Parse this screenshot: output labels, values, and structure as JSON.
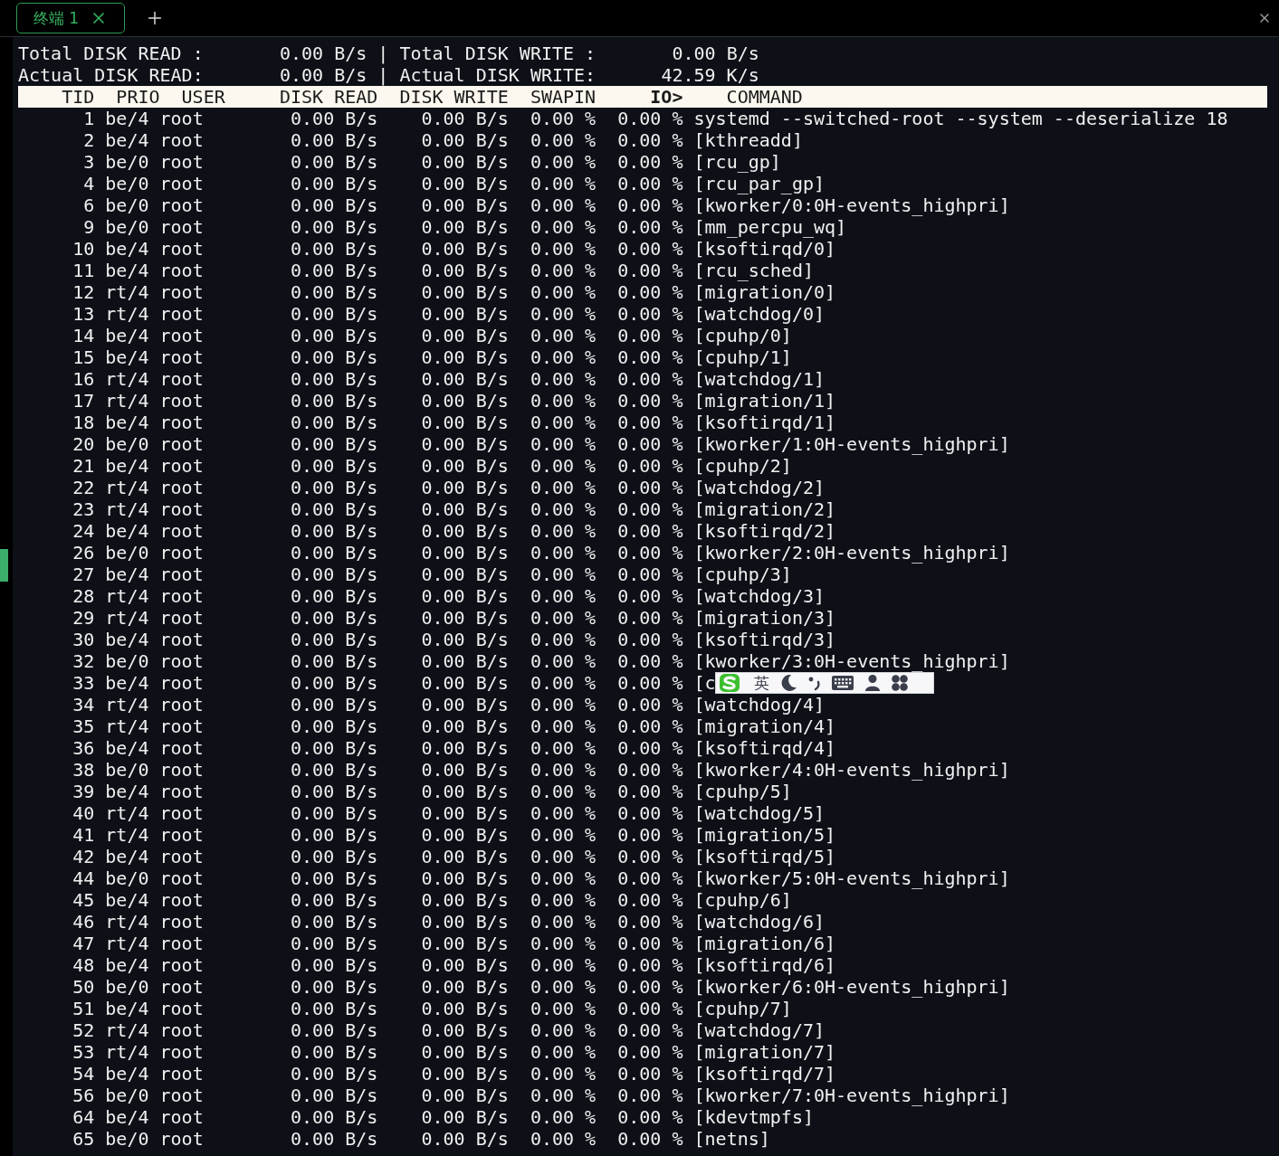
{
  "tabs": [
    {
      "label": "终端 1",
      "selected": true
    }
  ],
  "summary": [
    {
      "label": "Total DISK READ :",
      "value": "0.00 B/s",
      "separator": "|",
      "label2": "Total DISK WRITE :",
      "value2": "0.00 B/s"
    },
    {
      "label": "Actual DISK READ:",
      "value": "0.00 B/s",
      "separator": "|",
      "label2": "Actual DISK WRITE:",
      "value2": "42.59 K/s"
    }
  ],
  "columns": [
    {
      "label": "TID",
      "sorted": false
    },
    {
      "label": "PRIO",
      "sorted": false
    },
    {
      "label": "USER",
      "sorted": false
    },
    {
      "label": "DISK READ",
      "sorted": false
    },
    {
      "label": "DISK WRITE",
      "sorted": false
    },
    {
      "label": "SWAPIN",
      "sorted": false
    },
    {
      "label": "IO>",
      "sorted": true
    },
    {
      "label": "COMMAND",
      "sorted": false
    }
  ],
  "rows": [
    {
      "tid": "1",
      "prio": "be/4",
      "user": "root",
      "disk_read": "0.00 B/s",
      "disk_write": "0.00 B/s",
      "swapin": "0.00 %",
      "io": "0.00 %",
      "command": "systemd --switched-root --system --deserialize 18"
    },
    {
      "tid": "2",
      "prio": "be/4",
      "user": "root",
      "disk_read": "0.00 B/s",
      "disk_write": "0.00 B/s",
      "swapin": "0.00 %",
      "io": "0.00 %",
      "command": "[kthreadd]"
    },
    {
      "tid": "3",
      "prio": "be/0",
      "user": "root",
      "disk_read": "0.00 B/s",
      "disk_write": "0.00 B/s",
      "swapin": "0.00 %",
      "io": "0.00 %",
      "command": "[rcu_gp]"
    },
    {
      "tid": "4",
      "prio": "be/0",
      "user": "root",
      "disk_read": "0.00 B/s",
      "disk_write": "0.00 B/s",
      "swapin": "0.00 %",
      "io": "0.00 %",
      "command": "[rcu_par_gp]"
    },
    {
      "tid": "6",
      "prio": "be/0",
      "user": "root",
      "disk_read": "0.00 B/s",
      "disk_write": "0.00 B/s",
      "swapin": "0.00 %",
      "io": "0.00 %",
      "command": "[kworker/0:0H-events_highpri]"
    },
    {
      "tid": "9",
      "prio": "be/0",
      "user": "root",
      "disk_read": "0.00 B/s",
      "disk_write": "0.00 B/s",
      "swapin": "0.00 %",
      "io": "0.00 %",
      "command": "[mm_percpu_wq]"
    },
    {
      "tid": "10",
      "prio": "be/4",
      "user": "root",
      "disk_read": "0.00 B/s",
      "disk_write": "0.00 B/s",
      "swapin": "0.00 %",
      "io": "0.00 %",
      "command": "[ksoftirqd/0]"
    },
    {
      "tid": "11",
      "prio": "be/4",
      "user": "root",
      "disk_read": "0.00 B/s",
      "disk_write": "0.00 B/s",
      "swapin": "0.00 %",
      "io": "0.00 %",
      "command": "[rcu_sched]"
    },
    {
      "tid": "12",
      "prio": "rt/4",
      "user": "root",
      "disk_read": "0.00 B/s",
      "disk_write": "0.00 B/s",
      "swapin": "0.00 %",
      "io": "0.00 %",
      "command": "[migration/0]"
    },
    {
      "tid": "13",
      "prio": "rt/4",
      "user": "root",
      "disk_read": "0.00 B/s",
      "disk_write": "0.00 B/s",
      "swapin": "0.00 %",
      "io": "0.00 %",
      "command": "[watchdog/0]"
    },
    {
      "tid": "14",
      "prio": "be/4",
      "user": "root",
      "disk_read": "0.00 B/s",
      "disk_write": "0.00 B/s",
      "swapin": "0.00 %",
      "io": "0.00 %",
      "command": "[cpuhp/0]"
    },
    {
      "tid": "15",
      "prio": "be/4",
      "user": "root",
      "disk_read": "0.00 B/s",
      "disk_write": "0.00 B/s",
      "swapin": "0.00 %",
      "io": "0.00 %",
      "command": "[cpuhp/1]"
    },
    {
      "tid": "16",
      "prio": "rt/4",
      "user": "root",
      "disk_read": "0.00 B/s",
      "disk_write": "0.00 B/s",
      "swapin": "0.00 %",
      "io": "0.00 %",
      "command": "[watchdog/1]"
    },
    {
      "tid": "17",
      "prio": "rt/4",
      "user": "root",
      "disk_read": "0.00 B/s",
      "disk_write": "0.00 B/s",
      "swapin": "0.00 %",
      "io": "0.00 %",
      "command": "[migration/1]"
    },
    {
      "tid": "18",
      "prio": "be/4",
      "user": "root",
      "disk_read": "0.00 B/s",
      "disk_write": "0.00 B/s",
      "swapin": "0.00 %",
      "io": "0.00 %",
      "command": "[ksoftirqd/1]"
    },
    {
      "tid": "20",
      "prio": "be/0",
      "user": "root",
      "disk_read": "0.00 B/s",
      "disk_write": "0.00 B/s",
      "swapin": "0.00 %",
      "io": "0.00 %",
      "command": "[kworker/1:0H-events_highpri]"
    },
    {
      "tid": "21",
      "prio": "be/4",
      "user": "root",
      "disk_read": "0.00 B/s",
      "disk_write": "0.00 B/s",
      "swapin": "0.00 %",
      "io": "0.00 %",
      "command": "[cpuhp/2]"
    },
    {
      "tid": "22",
      "prio": "rt/4",
      "user": "root",
      "disk_read": "0.00 B/s",
      "disk_write": "0.00 B/s",
      "swapin": "0.00 %",
      "io": "0.00 %",
      "command": "[watchdog/2]"
    },
    {
      "tid": "23",
      "prio": "rt/4",
      "user": "root",
      "disk_read": "0.00 B/s",
      "disk_write": "0.00 B/s",
      "swapin": "0.00 %",
      "io": "0.00 %",
      "command": "[migration/2]"
    },
    {
      "tid": "24",
      "prio": "be/4",
      "user": "root",
      "disk_read": "0.00 B/s",
      "disk_write": "0.00 B/s",
      "swapin": "0.00 %",
      "io": "0.00 %",
      "command": "[ksoftirqd/2]"
    },
    {
      "tid": "26",
      "prio": "be/0",
      "user": "root",
      "disk_read": "0.00 B/s",
      "disk_write": "0.00 B/s",
      "swapin": "0.00 %",
      "io": "0.00 %",
      "command": "[kworker/2:0H-events_highpri]"
    },
    {
      "tid": "27",
      "prio": "be/4",
      "user": "root",
      "disk_read": "0.00 B/s",
      "disk_write": "0.00 B/s",
      "swapin": "0.00 %",
      "io": "0.00 %",
      "command": "[cpuhp/3]"
    },
    {
      "tid": "28",
      "prio": "rt/4",
      "user": "root",
      "disk_read": "0.00 B/s",
      "disk_write": "0.00 B/s",
      "swapin": "0.00 %",
      "io": "0.00 %",
      "command": "[watchdog/3]"
    },
    {
      "tid": "29",
      "prio": "rt/4",
      "user": "root",
      "disk_read": "0.00 B/s",
      "disk_write": "0.00 B/s",
      "swapin": "0.00 %",
      "io": "0.00 %",
      "command": "[migration/3]"
    },
    {
      "tid": "30",
      "prio": "be/4",
      "user": "root",
      "disk_read": "0.00 B/s",
      "disk_write": "0.00 B/s",
      "swapin": "0.00 %",
      "io": "0.00 %",
      "command": "[ksoftirqd/3]"
    },
    {
      "tid": "32",
      "prio": "be/0",
      "user": "root",
      "disk_read": "0.00 B/s",
      "disk_write": "0.00 B/s",
      "swapin": "0.00 %",
      "io": "0.00 %",
      "command": "[kworker/3:0H-events_highpri]"
    },
    {
      "tid": "33",
      "prio": "be/4",
      "user": "root",
      "disk_read": "0.00 B/s",
      "disk_write": "0.00 B/s",
      "swapin": "0.00 %",
      "io": "0.00 %",
      "command": "[c"
    },
    {
      "tid": "34",
      "prio": "rt/4",
      "user": "root",
      "disk_read": "0.00 B/s",
      "disk_write": "0.00 B/s",
      "swapin": "0.00 %",
      "io": "0.00 %",
      "command": "[watchdog/4]"
    },
    {
      "tid": "35",
      "prio": "rt/4",
      "user": "root",
      "disk_read": "0.00 B/s",
      "disk_write": "0.00 B/s",
      "swapin": "0.00 %",
      "io": "0.00 %",
      "command": "[migration/4]"
    },
    {
      "tid": "36",
      "prio": "be/4",
      "user": "root",
      "disk_read": "0.00 B/s",
      "disk_write": "0.00 B/s",
      "swapin": "0.00 %",
      "io": "0.00 %",
      "command": "[ksoftirqd/4]"
    },
    {
      "tid": "38",
      "prio": "be/0",
      "user": "root",
      "disk_read": "0.00 B/s",
      "disk_write": "0.00 B/s",
      "swapin": "0.00 %",
      "io": "0.00 %",
      "command": "[kworker/4:0H-events_highpri]"
    },
    {
      "tid": "39",
      "prio": "be/4",
      "user": "root",
      "disk_read": "0.00 B/s",
      "disk_write": "0.00 B/s",
      "swapin": "0.00 %",
      "io": "0.00 %",
      "command": "[cpuhp/5]"
    },
    {
      "tid": "40",
      "prio": "rt/4",
      "user": "root",
      "disk_read": "0.00 B/s",
      "disk_write": "0.00 B/s",
      "swapin": "0.00 %",
      "io": "0.00 %",
      "command": "[watchdog/5]"
    },
    {
      "tid": "41",
      "prio": "rt/4",
      "user": "root",
      "disk_read": "0.00 B/s",
      "disk_write": "0.00 B/s",
      "swapin": "0.00 %",
      "io": "0.00 %",
      "command": "[migration/5]"
    },
    {
      "tid": "42",
      "prio": "be/4",
      "user": "root",
      "disk_read": "0.00 B/s",
      "disk_write": "0.00 B/s",
      "swapin": "0.00 %",
      "io": "0.00 %",
      "command": "[ksoftirqd/5]"
    },
    {
      "tid": "44",
      "prio": "be/0",
      "user": "root",
      "disk_read": "0.00 B/s",
      "disk_write": "0.00 B/s",
      "swapin": "0.00 %",
      "io": "0.00 %",
      "command": "[kworker/5:0H-events_highpri]"
    },
    {
      "tid": "45",
      "prio": "be/4",
      "user": "root",
      "disk_read": "0.00 B/s",
      "disk_write": "0.00 B/s",
      "swapin": "0.00 %",
      "io": "0.00 %",
      "command": "[cpuhp/6]"
    },
    {
      "tid": "46",
      "prio": "rt/4",
      "user": "root",
      "disk_read": "0.00 B/s",
      "disk_write": "0.00 B/s",
      "swapin": "0.00 %",
      "io": "0.00 %",
      "command": "[watchdog/6]"
    },
    {
      "tid": "47",
      "prio": "rt/4",
      "user": "root",
      "disk_read": "0.00 B/s",
      "disk_write": "0.00 B/s",
      "swapin": "0.00 %",
      "io": "0.00 %",
      "command": "[migration/6]"
    },
    {
      "tid": "48",
      "prio": "be/4",
      "user": "root",
      "disk_read": "0.00 B/s",
      "disk_write": "0.00 B/s",
      "swapin": "0.00 %",
      "io": "0.00 %",
      "command": "[ksoftirqd/6]"
    },
    {
      "tid": "50",
      "prio": "be/0",
      "user": "root",
      "disk_read": "0.00 B/s",
      "disk_write": "0.00 B/s",
      "swapin": "0.00 %",
      "io": "0.00 %",
      "command": "[kworker/6:0H-events_highpri]"
    },
    {
      "tid": "51",
      "prio": "be/4",
      "user": "root",
      "disk_read": "0.00 B/s",
      "disk_write": "0.00 B/s",
      "swapin": "0.00 %",
      "io": "0.00 %",
      "command": "[cpuhp/7]"
    },
    {
      "tid": "52",
      "prio": "rt/4",
      "user": "root",
      "disk_read": "0.00 B/s",
      "disk_write": "0.00 B/s",
      "swapin": "0.00 %",
      "io": "0.00 %",
      "command": "[watchdog/7]"
    },
    {
      "tid": "53",
      "prio": "rt/4",
      "user": "root",
      "disk_read": "0.00 B/s",
      "disk_write": "0.00 B/s",
      "swapin": "0.00 %",
      "io": "0.00 %",
      "command": "[migration/7]"
    },
    {
      "tid": "54",
      "prio": "be/4",
      "user": "root",
      "disk_read": "0.00 B/s",
      "disk_write": "0.00 B/s",
      "swapin": "0.00 %",
      "io": "0.00 %",
      "command": "[ksoftirqd/7]"
    },
    {
      "tid": "56",
      "prio": "be/0",
      "user": "root",
      "disk_read": "0.00 B/s",
      "disk_write": "0.00 B/s",
      "swapin": "0.00 %",
      "io": "0.00 %",
      "command": "[kworker/7:0H-events_highpri]"
    },
    {
      "tid": "64",
      "prio": "be/4",
      "user": "root",
      "disk_read": "0.00 B/s",
      "disk_write": "0.00 B/s",
      "swapin": "0.00 %",
      "io": "0.00 %",
      "command": "[kdevtmpfs]"
    },
    {
      "tid": "65",
      "prio": "be/0",
      "user": "root",
      "disk_read": "0.00 B/s",
      "disk_write": "0.00 B/s",
      "swapin": "0.00 %",
      "io": "0.00 %",
      "command": "[netns]"
    }
  ],
  "ime_toolbar": {
    "mode": "英"
  }
}
